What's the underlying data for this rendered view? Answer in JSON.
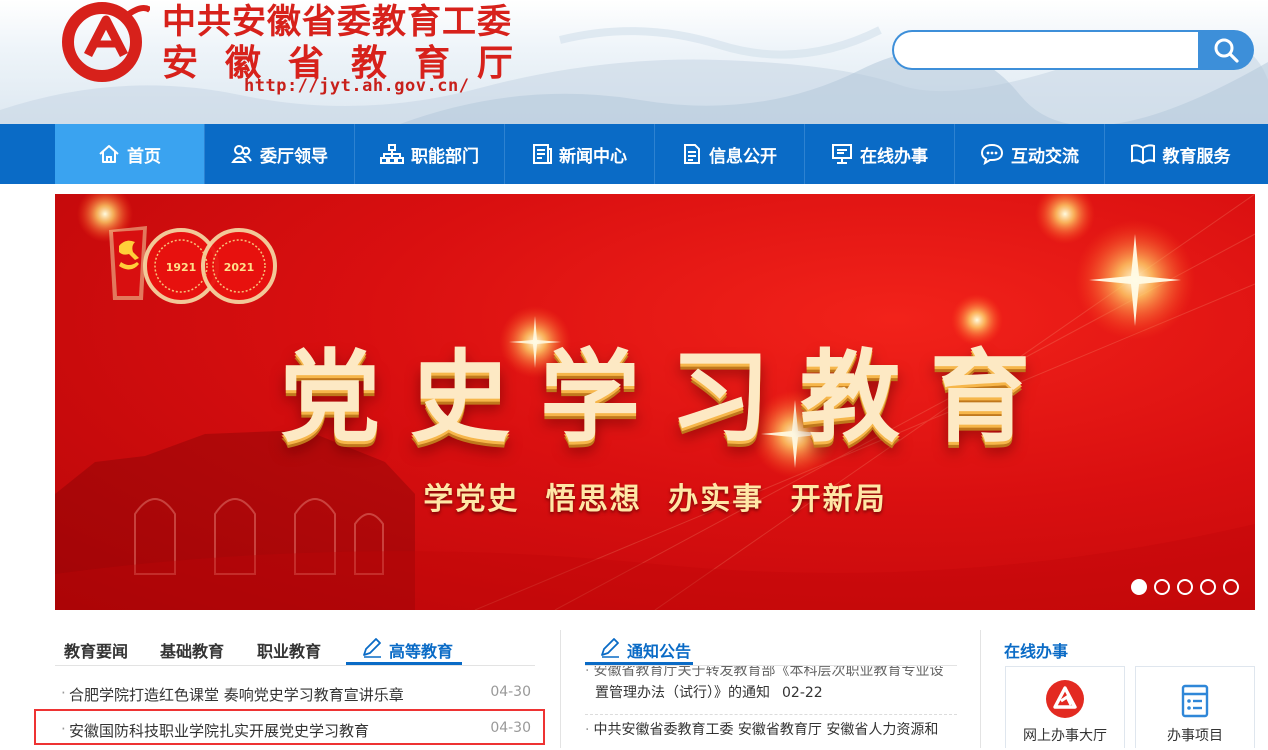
{
  "header": {
    "title_line1": "中共安徽省委教育工委",
    "title_line2": "安徽省教育厅",
    "url": "http://jyt.ah.gov.cn/",
    "search_placeholder": ""
  },
  "nav": {
    "items": [
      {
        "label": "首页",
        "icon": "home-icon",
        "active": true
      },
      {
        "label": "委厅领导",
        "icon": "leaders-icon"
      },
      {
        "label": "职能部门",
        "icon": "org-chart-icon"
      },
      {
        "label": "新闻中心",
        "icon": "news-icon"
      },
      {
        "label": "信息公开",
        "icon": "document-icon"
      },
      {
        "label": "在线办事",
        "icon": "monitor-icon"
      },
      {
        "label": "互动交流",
        "icon": "chat-icon"
      },
      {
        "label": "教育服务",
        "icon": "book-icon"
      }
    ]
  },
  "banner": {
    "badge_year_start": "1921",
    "badge_year_end": "2021",
    "title": "党史学习教育",
    "subtitle": "学党史 悟思想 办实事 开新局",
    "slide_count": 5,
    "active_slide": 1
  },
  "news": {
    "tabs": [
      "教育要闻",
      "基础教育",
      "职业教育",
      "高等教育"
    ],
    "active_tab": "高等教育",
    "items": [
      {
        "title": "合肥学院打造红色课堂 奏响党史学习教育宣讲乐章",
        "date": "04-30"
      },
      {
        "title": "安徽国防科技职业学院扎实开展党史学习教育",
        "date": "04-30"
      }
    ]
  },
  "notice": {
    "title": "通知公告",
    "items": [
      {
        "line1": "安徽省教育厅关于转发教育部《本科层次职业教育专业设",
        "line2": "置管理办法（试行）》的通知",
        "date": "02-22"
      },
      {
        "line1": "中共安徽省委教育工委 安徽省教育厅 安徽省人力资源和"
      }
    ]
  },
  "online": {
    "title": "在线办事",
    "services": [
      {
        "label": "网上办事大厅",
        "icon": "ahzwfw-logo-icon"
      },
      {
        "label": "办事项目",
        "icon": "list-document-icon"
      }
    ]
  },
  "colors": {
    "brand_red": "#d7211b",
    "nav_blue": "#0a6bc6",
    "nav_active": "#3aa3f0",
    "highlight_red": "#e33333"
  }
}
